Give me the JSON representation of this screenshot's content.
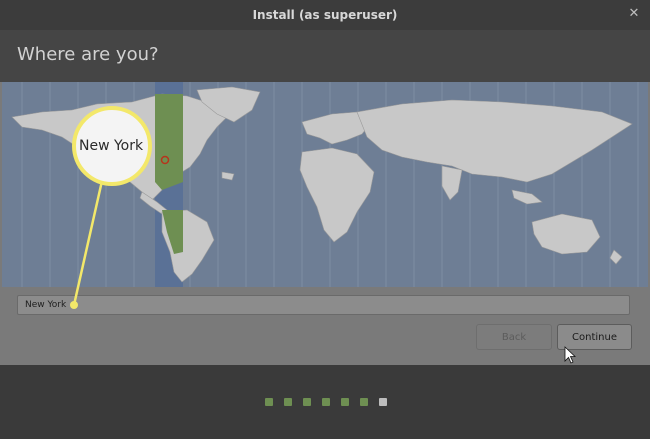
{
  "window": {
    "title": "Install (as superuser)",
    "close_glyph": "✕"
  },
  "page": {
    "title": "Where are you?"
  },
  "location": {
    "value": "New York",
    "zoom_label": "New York"
  },
  "buttons": {
    "back": "Back",
    "continue": "Continue"
  },
  "progress": {
    "total_steps": 7,
    "current_step": 7
  },
  "colors": {
    "accent_green": "#6e8f52",
    "highlight_yellow": "#f3e86a",
    "selected_timezone": "#5a7196",
    "marker_red": "#b8341c"
  },
  "icons": [
    "close-icon",
    "location-marker-icon",
    "mouse-pointer-icon"
  ]
}
